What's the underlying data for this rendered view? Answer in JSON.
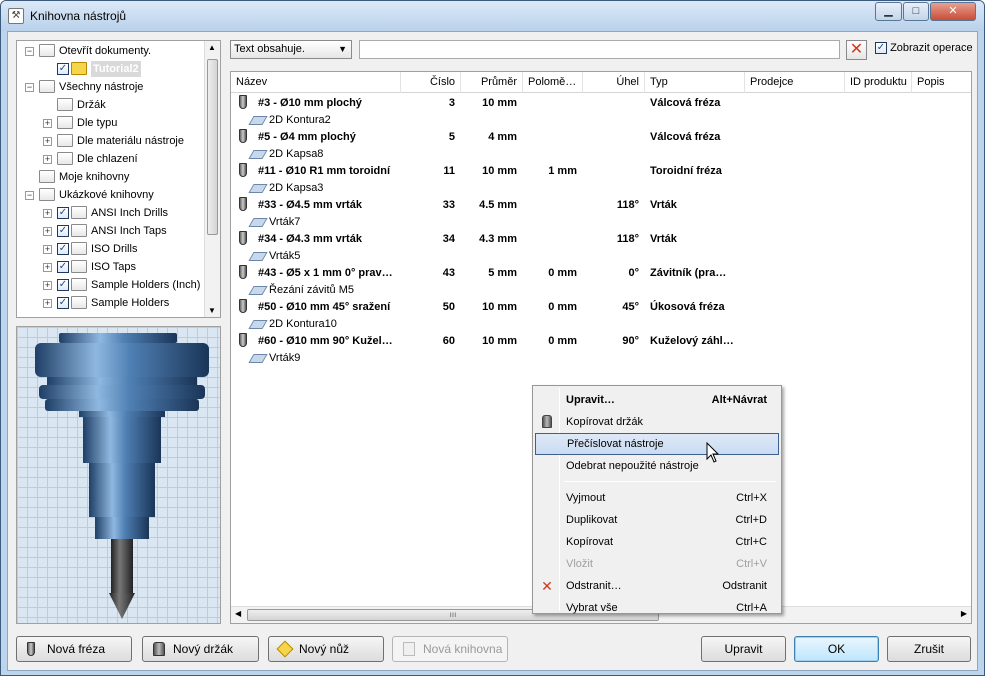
{
  "window": {
    "title": "Knihovna nástrojů"
  },
  "tree": {
    "items": [
      {
        "label": "Otevřít dokumenty.",
        "indent": 0,
        "expander": "−",
        "folder": true
      },
      {
        "label": "Tutorial2",
        "indent": 1,
        "check": true,
        "selected": true
      },
      {
        "label": "Všechny nástroje",
        "indent": 0,
        "expander": "−",
        "folder": true
      },
      {
        "label": "Držák",
        "indent": 1,
        "folder": true
      },
      {
        "label": "Dle typu",
        "indent": 1,
        "expander": "+",
        "folder": true
      },
      {
        "label": "Dle materiálu nástroje",
        "indent": 1,
        "expander": "+",
        "folder": true
      },
      {
        "label": "Dle chlazení",
        "indent": 1,
        "expander": "+",
        "folder": true
      },
      {
        "label": "Moje knihovny",
        "indent": 0,
        "folder": true
      },
      {
        "label": "Ukázkové knihovny",
        "indent": 0,
        "expander": "−",
        "folder": true
      },
      {
        "label": "ANSI Inch Drills",
        "indent": 1,
        "expander": "+",
        "check": true,
        "folder": true
      },
      {
        "label": "ANSI Inch Taps",
        "indent": 1,
        "expander": "+",
        "check": true,
        "folder": true
      },
      {
        "label": "ISO Drills",
        "indent": 1,
        "expander": "+",
        "check": true,
        "folder": true
      },
      {
        "label": "ISO Taps",
        "indent": 1,
        "expander": "+",
        "check": true,
        "folder": true
      },
      {
        "label": "Sample Holders (Inch)",
        "indent": 1,
        "expander": "+",
        "check": true,
        "folder": true
      },
      {
        "label": "Sample Holders",
        "indent": 1,
        "expander": "+",
        "check": true,
        "folder": true
      }
    ]
  },
  "filter": {
    "combo_value": "Text obsahuje.",
    "search_value": "",
    "show_ops_label": "Zobrazit operace"
  },
  "columns": [
    "Název",
    "Číslo",
    "Průměr",
    "Polomě…",
    "Úhel",
    "Typ",
    "Prodejce",
    "ID produktu",
    "Popis"
  ],
  "tools": [
    {
      "name": "#3 - Ø10 mm plochý",
      "num": "3",
      "dia": "10 mm",
      "rad": "",
      "angle": "",
      "type": "Válcová fréza",
      "op": "2D Kontura2"
    },
    {
      "name": "#5 - Ø4 mm plochý",
      "num": "5",
      "dia": "4 mm",
      "rad": "",
      "angle": "",
      "type": "Válcová fréza",
      "op": "2D Kapsa8"
    },
    {
      "name": "#11 - Ø10 R1 mm toroidní",
      "num": "11",
      "dia": "10 mm",
      "rad": "1 mm",
      "angle": "",
      "type": "Toroidní fréza",
      "op": "2D Kapsa3"
    },
    {
      "name": "#33 - Ø4.5 mm vrták",
      "num": "33",
      "dia": "4.5 mm",
      "rad": "",
      "angle": "118°",
      "type": "Vrták",
      "op": "Vrták7"
    },
    {
      "name": "#34 - Ø4.3 mm vrták",
      "num": "34",
      "dia": "4.3 mm",
      "rad": "",
      "angle": "118°",
      "type": "Vrták",
      "op": "Vrták5"
    },
    {
      "name": "#43 - Ø5 x 1 mm 0° prav…",
      "num": "43",
      "dia": "5 mm",
      "rad": "0 mm",
      "angle": "0°",
      "type": "Závitník (pra…",
      "op": "Řezání závitů M5"
    },
    {
      "name": "#50 - Ø10 mm 45° sražení",
      "num": "50",
      "dia": "10 mm",
      "rad": "0 mm",
      "angle": "45°",
      "type": "Úkosová fréza",
      "op": "2D Kontura10"
    },
    {
      "name": "#60 - Ø10 mm 90° Kužel…",
      "num": "60",
      "dia": "10 mm",
      "rad": "0 mm",
      "angle": "90°",
      "type": "Kuželový záhl…",
      "op": "Vrták9"
    }
  ],
  "context_menu": [
    {
      "label": "Upravit…",
      "shortcut": "Alt+Návrat",
      "bold": true
    },
    {
      "label": "Kopírovat držák",
      "shortcut": "",
      "icon": "holder-icon"
    },
    {
      "label": "Přečíslovat nástroje",
      "shortcut": "",
      "selected": true
    },
    {
      "label": "Odebrat nepoužité nástroje",
      "shortcut": ""
    },
    {
      "sep": true
    },
    {
      "label": "Vyjmout",
      "shortcut": "Ctrl+X"
    },
    {
      "label": "Duplikovat",
      "shortcut": "Ctrl+D"
    },
    {
      "label": "Kopírovat",
      "shortcut": "Ctrl+C"
    },
    {
      "label": "Vložit",
      "shortcut": "Ctrl+V",
      "disabled": true
    },
    {
      "label": "Odstranit…",
      "shortcut": "Odstranit",
      "icon": "delete-icon"
    },
    {
      "label": "Vybrat vše",
      "shortcut": "Ctrl+A"
    }
  ],
  "buttons": {
    "new_mill": "Nová fréza",
    "new_holder": "Nový držák",
    "new_knife": "Nový nůž",
    "new_library": "Nová knihovna",
    "edit": "Upravit",
    "ok": "OK",
    "cancel": "Zrušit"
  },
  "colors": {
    "accent": "#3c7fb1",
    "delete_red": "#d23a1c",
    "selection": "#c9dbf2"
  }
}
